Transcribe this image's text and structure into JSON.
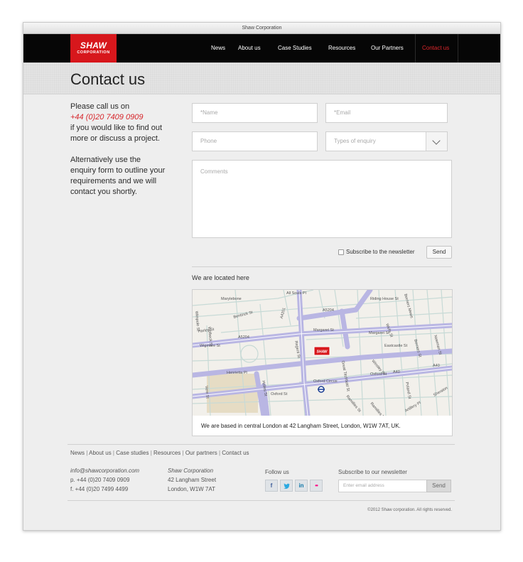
{
  "window": {
    "title": "Shaw Corporation"
  },
  "logo": {
    "line1": "SHAW",
    "line2": "CORPORATION",
    "brand_color": "#d7171c"
  },
  "nav": {
    "items": [
      {
        "label": "News"
      },
      {
        "label": "About us"
      },
      {
        "label": "Case Studies"
      },
      {
        "label": "Resources"
      },
      {
        "label": "Our  Partners"
      },
      {
        "label": "Contact us",
        "active": true
      }
    ],
    "active_color": "#e0262b"
  },
  "page": {
    "title": "Contact us"
  },
  "intro": {
    "line_before": "Please call us on",
    "phone": "+44 (0)20 7409 0909",
    "line_after": "if you would like to find out more or discuss a project.",
    "para2": "Alternatively use the enquiry form to outline your requirements and we will contact you shortly."
  },
  "form": {
    "name_placeholder": "*Name",
    "email_placeholder": "*Email",
    "phone_placeholder": "Phone",
    "enquiry_placeholder": "Types of enquiry",
    "comments_placeholder": "Comments",
    "subscribe_label": "Subscribe to the newsletter",
    "send_label": "Send"
  },
  "location": {
    "heading": "We are located here",
    "caption": "We are based in central London at 42 Langham Street, London, W1W 7AT, UK.",
    "marker": "SHAW",
    "streets": [
      "Marylebone",
      "A5204",
      "A4201",
      "Regent St",
      "Wigmore St",
      "A5204",
      "Margaret St",
      "Eastcastle St",
      "Henrietta Pl",
      "Oxford St",
      "Oxford St",
      "A40",
      "A40",
      "Oxford Circus",
      "Winsley St",
      "Poland St",
      "Berners Mews",
      "Berners St",
      "Wells St",
      "Newman St",
      "Holles St",
      "Vere St",
      "Welbeck St",
      "All Souls Pl",
      "Riding House St",
      "Margaret St",
      "Great Titchfield St",
      "Ramillies St",
      "Ramillies Pl",
      "Sheraton",
      "Artillery Pl",
      "Bentinck St",
      "Wimpole St",
      "Harley St"
    ]
  },
  "footer": {
    "links": [
      "News",
      "About us",
      "Case studies",
      "Resources",
      "Our partners",
      "Contact us"
    ],
    "email": "info@shawcorporation.com",
    "phone": "p. +44 (0)20 7409 0909",
    "fax": "f. +44 (0)20 7499 4499",
    "company": "Shaw Corporation",
    "street": "42 Langham Street",
    "city": "London, W1W 7AT",
    "follow_label": "Follow us",
    "social": [
      {
        "icon": "facebook-icon",
        "glyph": "f",
        "color": "#3b5998"
      },
      {
        "icon": "twitter-icon",
        "glyph": "t",
        "color": "#2ba9e1"
      },
      {
        "icon": "linkedin-icon",
        "glyph": "in",
        "color": "#0e76a8"
      },
      {
        "icon": "flickr-icon",
        "glyph": "••",
        "color": "#ff0084"
      }
    ],
    "newsletter_label": "Subscribe to our newsletter",
    "newsletter_placeholder": "Enter email address",
    "newsletter_button": "Send",
    "copyright": "©2012 Shaw corporation. All rights reserved."
  }
}
